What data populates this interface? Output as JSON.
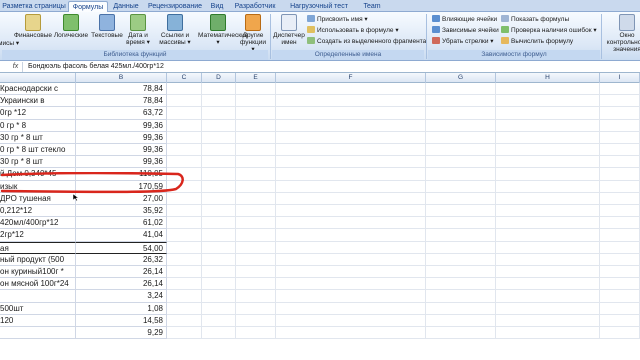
{
  "tabs": [
    "Разметка страницы",
    "Формулы",
    "Данные",
    "Рецензирование",
    "Вид",
    "Разработчик",
    "Нагрузочный тест",
    "Team"
  ],
  "active_tab": "Формулы",
  "ribbon": {
    "left_cut": "мисы ▾",
    "library": {
      "buttons": [
        "Финансовые",
        "Логические",
        "Текстовые",
        "Дата и время ▾",
        "Ссылки и массивы ▾",
        "Математические ▾",
        "Другие функции ▾"
      ],
      "caption": "Библиотека функций"
    },
    "names": {
      "manager": "Диспетчер имен",
      "assign": "Присвоить имя ▾",
      "use_in_formula": "Использовать в формуле ▾",
      "create_from_selection": "Создать из выделенного фрагмента",
      "caption": "Определенные имена"
    },
    "audit": {
      "influencing": "Влияющие ячейки",
      "dependent": "Зависимые ячейки",
      "remove_arrows": "Убрать стрелки ▾",
      "show_formulas": "Показать формулы",
      "error_check": "Проверка наличия ошибок ▾",
      "evaluate": "Вычислить формулу",
      "caption": "Зависимости формул"
    },
    "right_cut": "Окно контрольного значения"
  },
  "formula_bar": {
    "fx": "fx",
    "content": "Бондюэль фасоль белая  425мл./400гр*12"
  },
  "columns": [
    "B",
    "C",
    "D",
    "E",
    "F",
    "G",
    "H",
    "I"
  ],
  "rows": [
    {
      "a": "Краснодарски с",
      "b": "78,84"
    },
    {
      "a": "Украински в",
      "b": "78,84"
    },
    {
      "a": "0гр *12",
      "b": "63,72"
    },
    {
      "a": "0 гр * 8",
      "b": "99,36"
    },
    {
      "a": "30 гр * 8 шт",
      "b": "99,36"
    },
    {
      "a": "0 гр * 8 шт стекло",
      "b": "99,36"
    },
    {
      "a": "30 гр * 8 шт",
      "b": "99,36"
    },
    {
      "a": "й Дом 0,340*45",
      "b": "110,05"
    },
    {
      "a": "изык",
      "b": "170,59"
    },
    {
      "a": "ДРО тушеная",
      "b": "27,00"
    },
    {
      "a": "0,212*12",
      "b": "35,92"
    },
    {
      "a": " 420мл/400гр*12",
      "b": "61,02"
    },
    {
      "a": "2гр*12",
      "b": "41,04"
    },
    {
      "a": "ая",
      "b": "54,00"
    },
    {
      "a": "ный продукт (500",
      "b": "26,32"
    },
    {
      "a": "он куриный100г *",
      "b": "26,14"
    },
    {
      "a": "он мясной 100г*24",
      "b": "26,14"
    },
    {
      "a": "",
      "b": "3,24"
    },
    {
      "a": "500шт",
      "b": "1,08"
    },
    {
      "a": "120",
      "b": "14,58"
    },
    {
      "a": "",
      "b": "9,29"
    }
  ]
}
